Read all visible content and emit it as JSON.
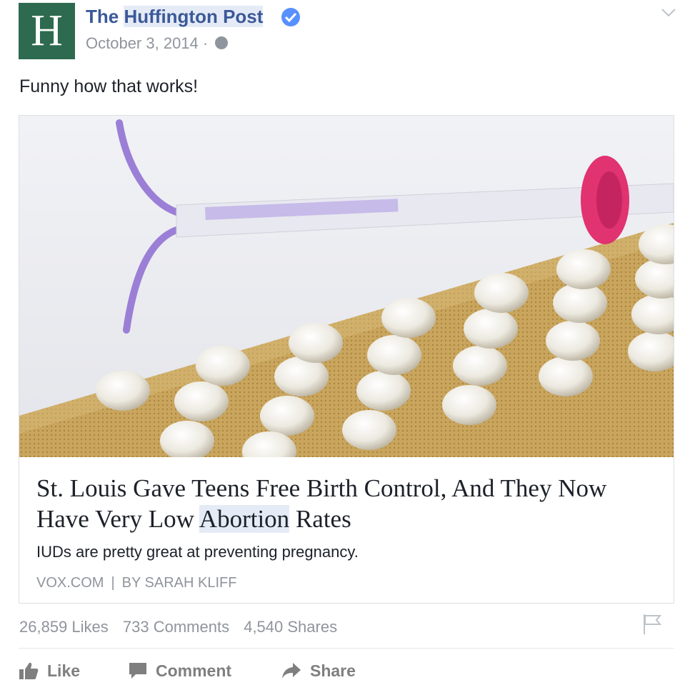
{
  "post": {
    "page_name_prefix": "The",
    "page_name_highlight": "Huffington Post",
    "date": "October 3, 2014",
    "date_separator": "·",
    "avatar_letter": "H",
    "status_text": "Funny how that works!",
    "icons": [
      "verified-badge-icon",
      "globe-icon",
      "chevron-down-icon",
      "flag-icon",
      "like-icon",
      "comment-icon",
      "share-icon"
    ]
  },
  "link": {
    "title_before": "St. Louis Gave Teens Free Birth Control, And They Now Have Very Low",
    "title_highlight": "Abortion",
    "title_after": "Rates",
    "description": "IUDs are pretty great at preventing pregnancy.",
    "source": "VOX.COM",
    "source_separator": "|",
    "author": "BY SARAH KLIFF"
  },
  "stats": {
    "likes": "26,859 Likes",
    "comments": "733 Comments",
    "shares": "4,540 Shares"
  },
  "actions": {
    "like": "Like",
    "comment": "Comment",
    "share": "Share"
  },
  "colors": {
    "link_blue": "#3b5998",
    "verified_blue": "#5890ff",
    "meta_gray": "#90949c",
    "avatar_green": "#2d6a4f"
  }
}
